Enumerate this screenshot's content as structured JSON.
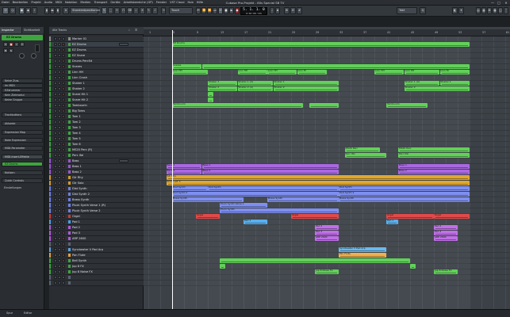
{
  "window": {
    "title": "Cubase Pro-Projekt - 80s Special SB TV",
    "menu": [
      "Datei",
      "Bearbeiten",
      "Projekt",
      "Audio",
      "MIDI",
      "Notation",
      "Medien",
      "Transport",
      "Geräte",
      "Arbeitsbereiche (GP)",
      "Fenster",
      "VST Cloud",
      "Hub",
      "Hilfe"
    ],
    "controls": [
      "—",
      "□",
      "✕"
    ]
  },
  "toolbar": {
    "quantize_label": "Standardpositionen",
    "touch_label": "Touch",
    "grid_label": "Takt",
    "display_main": "5. 1. 1. 0",
    "display_sub": "0:00:08.745"
  },
  "inspector": {
    "tabs": [
      "Inspector",
      "Sichtbarkeit"
    ],
    "track_name": "EZ Drums",
    "labels": [
      "Keine Zuw.",
      "Im MIDI",
      "EZdrummer",
      "Kein Zielmodul",
      "Keine Gruppe"
    ],
    "sections": [
      "Trackbuttons",
      "Akkorde",
      "Expression Map",
      "Note Expression",
      "MIDI-Parameter",
      "MIDI-Insert-Effekte",
      "EZ Drums",
      "Notizen",
      "Quick Controls",
      "Einstellungen"
    ],
    "highlight_sections": [
      "MIDI-Insert-Effekte",
      "EZ Drums"
    ]
  },
  "tracklist": {
    "header_label": "Alle Tracks",
    "tracks": [
      {
        "name": "Marker 01",
        "color": "#8d8d8d"
      },
      {
        "name": "EZ Drums",
        "color": "#3ea53e"
      },
      {
        "name": "EZ Drums",
        "color": "#3ea53e"
      },
      {
        "name": "EZ Snare",
        "color": "#3ea53e"
      },
      {
        "name": "Drums PercEd",
        "color": "#3ea53e"
      },
      {
        "name": "Snares",
        "color": "#3ea53e"
      },
      {
        "name": "Linn HH",
        "color": "#3ea53e"
      },
      {
        "name": "Linn Crash",
        "color": "#3ea53e"
      },
      {
        "name": "Shaker 1",
        "color": "#3ea53e"
      },
      {
        "name": "Shaker 2",
        "color": "#3ea53e"
      },
      {
        "name": "Snare Hit 1",
        "color": "#3ea53e"
      },
      {
        "name": "Snare Hit 2",
        "color": "#3ea53e"
      },
      {
        "name": "Tambourin",
        "color": "#3ea53e"
      },
      {
        "name": "Big Toms",
        "color": "#3ea53e"
      },
      {
        "name": "Tom 1",
        "color": "#3ea53e"
      },
      {
        "name": "Tom 2",
        "color": "#3ea53e"
      },
      {
        "name": "Tom 3",
        "color": "#3ea53e"
      },
      {
        "name": "Tom 4",
        "color": "#3ea53e"
      },
      {
        "name": "Tom 5",
        "color": "#3ea53e"
      },
      {
        "name": "Tom 6",
        "color": "#3ea53e"
      },
      {
        "name": "MS20 Perc (R)",
        "color": "#3ea53e"
      },
      {
        "name": "Perc Ifal",
        "color": "#3ea53e"
      },
      {
        "name": "Bass",
        "color": "#9b55d0"
      },
      {
        "name": "Bass 1",
        "color": "#9b55d0"
      },
      {
        "name": "Bass 2",
        "color": "#9b55d0"
      },
      {
        "name": "Gtr Rhy",
        "color": "#d09a2a"
      },
      {
        "name": "Gtr Solo",
        "color": "#d09a2a"
      },
      {
        "name": "Dist Synth",
        "color": "#6f7fe0"
      },
      {
        "name": "Dist Synth 2",
        "color": "#6f7fe0"
      },
      {
        "name": "Brass Synth",
        "color": "#6f7fe0"
      },
      {
        "name": "Pluck Synth Verse 1 (R)",
        "color": "#6f7fe0"
      },
      {
        "name": "Pluck Synth Verse 2",
        "color": "#6f7fe0"
      },
      {
        "name": "Orgel",
        "color": "#d03a3a"
      },
      {
        "name": "Pad 1",
        "color": "#4aa0e0"
      },
      {
        "name": "Pad 2",
        "color": "#b05ad8"
      },
      {
        "name": "Pad 3",
        "color": "#b05ad8"
      },
      {
        "name": "ARP 2600",
        "color": "#b05ad8"
      },
      {
        "name": "",
        "color": "#5a6470"
      },
      {
        "name": "Syncbeater V Pad Arp",
        "color": "#5aa0e0"
      },
      {
        "name": "Pan Flute",
        "color": "#e0a040"
      },
      {
        "name": "Bell Synth",
        "color": "#3ea53e"
      },
      {
        "name": "Jup 8 FX",
        "color": "#3ea53e"
      },
      {
        "name": "Jup 8 Noise FX",
        "color": "#3ea53e"
      },
      {
        "name": "",
        "color": "#5a6470"
      },
      {
        "name": "",
        "color": "#5a6470"
      }
    ]
  },
  "ruler": {
    "bars": [
      "1",
      "5",
      "9",
      "13",
      "17",
      "21",
      "25",
      "29",
      "33",
      "37",
      "41",
      "45",
      "49",
      "53",
      "57",
      "61",
      "65"
    ]
  },
  "clips": [
    {
      "lane": 1,
      "start": 5,
      "end": 55,
      "color": "#62d05a",
      "label": "EZ Drums"
    },
    {
      "lane": 5,
      "start": 5,
      "end": 10,
      "color": "#62d05a",
      "label": "Snares"
    },
    {
      "lane": 5,
      "start": 10,
      "end": 55,
      "color": "#62d05a",
      "label": ""
    },
    {
      "lane": 6,
      "start": 5,
      "end": 11,
      "color": "#62d05a",
      "label": "Linn HH"
    },
    {
      "lane": 6,
      "start": 16,
      "end": 21,
      "color": "#62d05a",
      "label": "Linn HH"
    },
    {
      "lane": 6,
      "start": 21,
      "end": 26,
      "color": "#62d05a",
      "label": "Linn HH"
    },
    {
      "lane": 6,
      "start": 26,
      "end": 31,
      "color": "#62d05a",
      "label": "Linn Fil"
    },
    {
      "lane": 6,
      "start": 39,
      "end": 44,
      "color": "#62d05a",
      "label": "Linn HH"
    },
    {
      "lane": 6,
      "start": 44,
      "end": 50,
      "color": "#62d05a",
      "label": "Linn HH"
    },
    {
      "lane": 6,
      "start": 50,
      "end": 55,
      "color": "#62d05a",
      "label": "Linn Fil"
    },
    {
      "lane": 8,
      "start": 11,
      "end": 16,
      "color": "#62d05a",
      "label": "Shaker 1"
    },
    {
      "lane": 8,
      "start": 16,
      "end": 22,
      "color": "#62d05a",
      "label": "Shaker 1 (A)"
    },
    {
      "lane": 8,
      "start": 22,
      "end": 33,
      "color": "#62d05a",
      "label": "Shaker 1"
    },
    {
      "lane": 8,
      "start": 44,
      "end": 50,
      "color": "#62d05a",
      "label": "Shaker 1 (A)"
    },
    {
      "lane": 8,
      "start": 50,
      "end": 55,
      "color": "#62d05a",
      "label": "Shaker 1"
    },
    {
      "lane": 9,
      "start": 11,
      "end": 16,
      "color": "#62d05a",
      "label": "Shaker 2"
    },
    {
      "lane": 9,
      "start": 16,
      "end": 22,
      "color": "#62d05a",
      "label": "Shaker 2 (A)"
    },
    {
      "lane": 9,
      "start": 22,
      "end": 33,
      "color": "#62d05a",
      "label": "Shaker 2"
    },
    {
      "lane": 9,
      "start": 44,
      "end": 55,
      "color": "#62d05a",
      "label": "Shaker 2"
    },
    {
      "lane": 10,
      "start": 11,
      "end": 12,
      "color": "#62d05a",
      "label": ""
    },
    {
      "lane": 11,
      "start": 11,
      "end": 12,
      "color": "#62d05a",
      "label": ""
    },
    {
      "lane": 12,
      "start": 5,
      "end": 27,
      "color": "#62d05a",
      "label": "Tambourin"
    },
    {
      "lane": 12,
      "start": 28,
      "end": 33,
      "color": "#62d05a",
      "label": ""
    },
    {
      "lane": 12,
      "start": 41,
      "end": 48,
      "color": "#62d05a",
      "label": "Tambourin"
    },
    {
      "lane": 20,
      "start": 34,
      "end": 40,
      "color": "#62d05a",
      "label": "MS20 Perc"
    },
    {
      "lane": 20,
      "start": 43,
      "end": 55,
      "color": "#62d05a",
      "label": "MS20 Perc"
    },
    {
      "lane": 21,
      "start": 34,
      "end": 41,
      "color": "#62d05a",
      "label": "Perc Ifal"
    },
    {
      "lane": 21,
      "start": 43,
      "end": 55,
      "color": "#62d05a",
      "label": "Perc Ifal"
    },
    {
      "lane": 23,
      "start": 4,
      "end": 10,
      "color": "#a968e0",
      "label": "Bass 1"
    },
    {
      "lane": 23,
      "start": 10,
      "end": 33,
      "color": "#a968e0",
      "label": "Bass 1"
    },
    {
      "lane": 23,
      "start": 43,
      "end": 55,
      "color": "#a968e0",
      "label": "Bass 1"
    },
    {
      "lane": 24,
      "start": 4,
      "end": 10,
      "color": "#a968e0",
      "label": "Bass 2"
    },
    {
      "lane": 24,
      "start": 10,
      "end": 33,
      "color": "#a968e0",
      "label": "Bass 2"
    },
    {
      "lane": 24,
      "start": 43,
      "end": 55,
      "color": "#a968e0",
      "label": "Bass 2"
    },
    {
      "lane": 25,
      "start": 4,
      "end": 55,
      "color": "#e0a830",
      "label": "Gtr Rhy"
    },
    {
      "lane": 26,
      "start": 4,
      "end": 55,
      "color": "#e0a830",
      "label": "SOLO GIT 3"
    },
    {
      "lane": 27,
      "start": 5,
      "end": 11,
      "color": "#7f8ff0",
      "label": "Dist Synth"
    },
    {
      "lane": 27,
      "start": 11,
      "end": 33,
      "color": "#7f8ff0",
      "label": "Dist Synth"
    },
    {
      "lane": 27,
      "start": 33,
      "end": 55,
      "color": "#7f8ff0",
      "label": "Dist Synth"
    },
    {
      "lane": 28,
      "start": 5,
      "end": 33,
      "color": "#7f8ff0",
      "label": "Dist Synth 2"
    },
    {
      "lane": 28,
      "start": 33,
      "end": 55,
      "color": "#7f8ff0",
      "label": "Dist Synth 2"
    },
    {
      "lane": 29,
      "start": 5,
      "end": 17,
      "color": "#7f8ff0",
      "label": "Brass Synth"
    },
    {
      "lane": 29,
      "start": 21,
      "end": 33,
      "color": "#7f8ff0",
      "label": "Brass Synth"
    },
    {
      "lane": 29,
      "start": 33,
      "end": 55,
      "color": "#7f8ff0",
      "label": "Brass Synth"
    },
    {
      "lane": 30,
      "start": 13,
      "end": 21,
      "color": "#7f8ff0",
      "label": "Pluck Synth Verse 1"
    },
    {
      "lane": 31,
      "start": 13,
      "end": 33,
      "color": "#7f8ff0",
      "label": "Pluck Synth"
    },
    {
      "lane": 32,
      "start": 9,
      "end": 13,
      "color": "#e04a4a",
      "label": "Orgel"
    },
    {
      "lane": 32,
      "start": 25,
      "end": 33,
      "color": "#e04a4a",
      "label": "Orgel"
    },
    {
      "lane": 32,
      "start": 41,
      "end": 49,
      "color": "#e04a4a",
      "label": "Orgel"
    },
    {
      "lane": 32,
      "start": 49,
      "end": 55,
      "color": "#e04a4a",
      "label": "Orgel"
    },
    {
      "lane": 33,
      "start": 17,
      "end": 21,
      "color": "#5ab0f0",
      "label": "Pad 1"
    },
    {
      "lane": 33,
      "start": 41,
      "end": 43,
      "color": "#5ab0f0",
      "label": "Pad 1"
    },
    {
      "lane": 34,
      "start": 29,
      "end": 33,
      "color": "#c070e8",
      "label": "Pad 2"
    },
    {
      "lane": 34,
      "start": 49,
      "end": 53,
      "color": "#c070e8",
      "label": "Pad 2"
    },
    {
      "lane": 35,
      "start": 29,
      "end": 33,
      "color": "#c070e8",
      "label": "Pad 3"
    },
    {
      "lane": 35,
      "start": 49,
      "end": 53,
      "color": "#c070e8",
      "label": "Pad 3"
    },
    {
      "lane": 36,
      "start": 29,
      "end": 33,
      "color": "#c070e8",
      "label": "ARP 2600"
    },
    {
      "lane": 36,
      "start": 49,
      "end": 53,
      "color": "#c070e8",
      "label": "ARP 2600"
    },
    {
      "lane": 38,
      "start": 33,
      "end": 41,
      "color": "#6ab8f0",
      "label": "Syncbeater V Pad Arp"
    },
    {
      "lane": 39,
      "start": 33,
      "end": 41,
      "color": "#f0b050",
      "label": "Pan Flute"
    },
    {
      "lane": 40,
      "start": 13,
      "end": 45,
      "color": "#62d05a",
      "label": ""
    },
    {
      "lane": 41,
      "start": 13,
      "end": 14,
      "color": "#62d05a",
      "label": ""
    },
    {
      "lane": 41,
      "start": 45,
      "end": 46,
      "color": "#62d05a",
      "label": ""
    },
    {
      "lane": 42,
      "start": 29,
      "end": 33,
      "color": "#62d05a",
      "label": "Jup 8 Noise FX"
    },
    {
      "lane": 42,
      "start": 49,
      "end": 53,
      "color": "#62d05a",
      "label": "Jup 8 Noise FX"
    }
  ],
  "transport": {
    "cursor_bar": 5,
    "locator_start": 5,
    "locator_end": 55
  },
  "bottombar": {
    "tabs": [
      "Spur",
      "Editor"
    ]
  }
}
